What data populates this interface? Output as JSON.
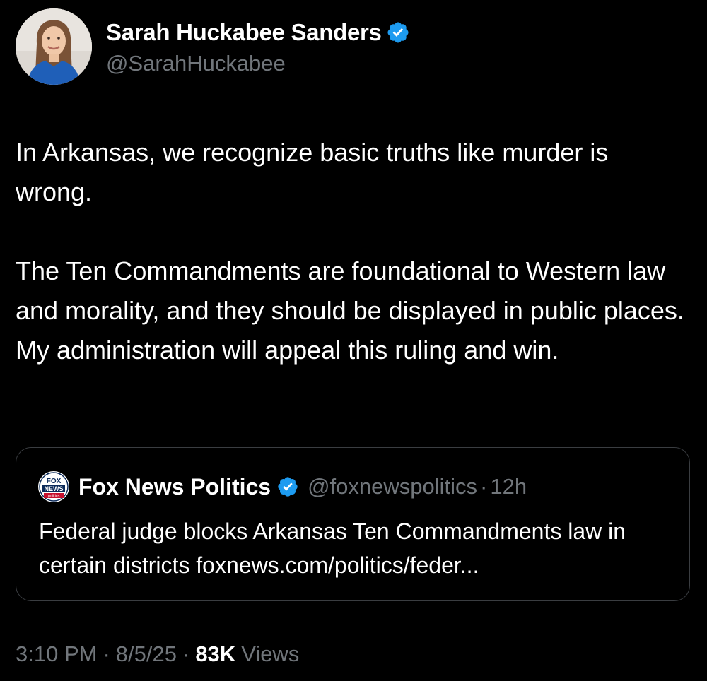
{
  "author": {
    "display_name": "Sarah Huckabee Sanders",
    "handle": "@SarahHuckabee",
    "verified_icon": "verified-badge-icon"
  },
  "post": {
    "paragraphs": [
      "In Arkansas, we recognize basic truths like murder is wrong.",
      "The Ten Commandments are foundational to Western law and morality, and they should be displayed in public places. My administration will appeal this ruling and win."
    ]
  },
  "quoted_post": {
    "display_name": "Fox News Politics",
    "handle": "@foxnewspolitics",
    "separator": "·",
    "time": "12h",
    "text": "Federal judge blocks Arkansas Ten Commandments law in certain districts foxnews.com/politics/feder...",
    "logo_icon": "fox-news-politics-logo",
    "logo_text": "FOX NEWS politics"
  },
  "meta": {
    "time": "3:10 PM",
    "separator": "·",
    "date": "8/5/25",
    "views_count": "83K",
    "views_label": "Views"
  },
  "colors": {
    "background": "#000000",
    "primary_text": "#ffffff",
    "secondary_text": "#71767b",
    "verified_blue": "#1d9bf0",
    "card_border": "#3a3d41"
  }
}
